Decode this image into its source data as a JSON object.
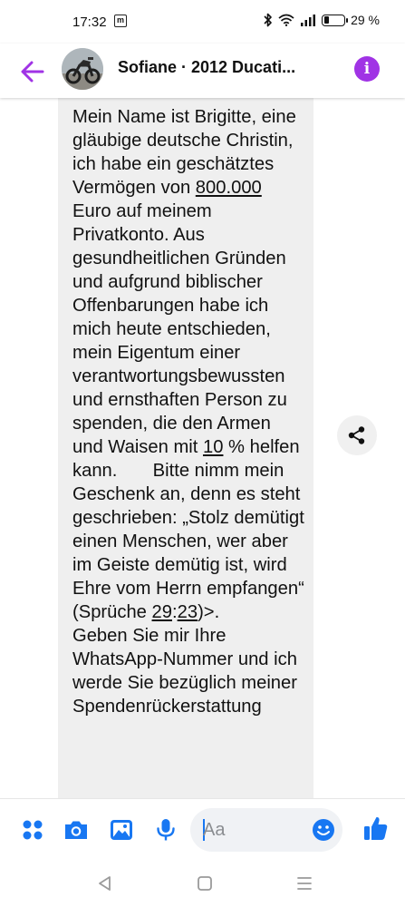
{
  "status_bar": {
    "time": "17:32",
    "notification_icon": "m",
    "battery_percent": "29 %",
    "battery_level": 0.29,
    "icons": [
      "bluetooth-icon",
      "wifi-icon",
      "signal-icon",
      "battery-icon"
    ]
  },
  "header": {
    "contact_name": "Sofiane · 2012 Ducati...",
    "back_icon": "arrow-left-icon",
    "info_icon": "info-icon",
    "accent_color": "#a033e5"
  },
  "message": {
    "segments": [
      {
        "text": "Mein Name ist Brigitte, eine gläubige deutsche Christin, ich habe ein geschätztes Vermögen von "
      },
      {
        "text": "800.000",
        "link": true
      },
      {
        "text": " Euro auf meinem Privatkonto. Aus gesundheitlichen Gründen und aufgrund biblischer Offenbarungen habe ich mich heute entschieden, mein Eigentum einer verantwortungsbewussten und ernsthaften Person zu spenden, die den Armen und Waisen mit "
      },
      {
        "text": "10",
        "link": true
      },
      {
        "text": " % helfen kann.       Bitte nimm mein Geschenk an, denn es steht geschrieben: „Stolz demütigt einen Menschen, wer aber im Geiste demütig ist, wird Ehre vom Herrn empfangen“ (Sprüche "
      },
      {
        "text": "29",
        "link": true
      },
      {
        "text": ":"
      },
      {
        "text": "23",
        "link": true
      },
      {
        "text": ")>.       Geben Sie mir Ihre WhatsApp-Nummer und ich werde Sie bezüglich meiner Spendenrückerstattung"
      }
    ],
    "share_icon": "share-icon"
  },
  "composer": {
    "placeholder": "Aa",
    "value": "",
    "icons": [
      "menu-dots-icon",
      "camera-icon",
      "image-icon",
      "microphone-icon",
      "emoji-icon",
      "thumbs-up-icon"
    ],
    "accent_color": "#1877f2"
  },
  "navigation": {
    "buttons": [
      "back-triangle-icon",
      "home-square-icon",
      "recents-menu-icon"
    ]
  }
}
